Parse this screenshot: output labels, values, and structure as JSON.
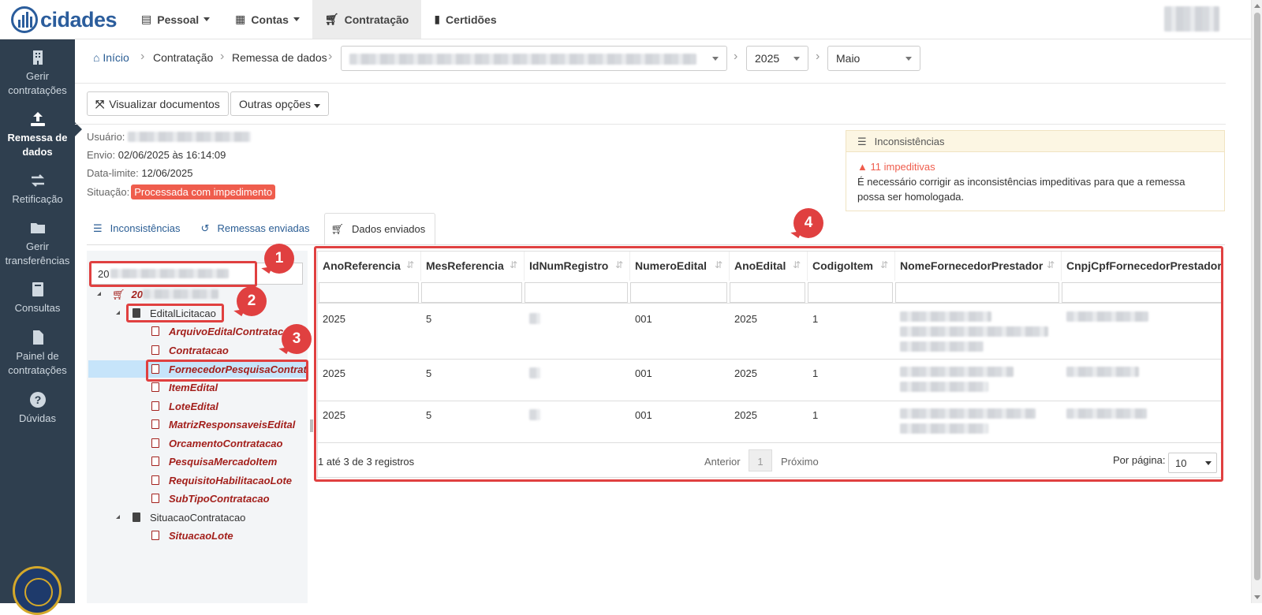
{
  "app": {
    "brand": "cidades"
  },
  "topnav": [
    {
      "label": "Pessoal",
      "icon": "id-card-icon",
      "dropdown": true
    },
    {
      "label": "Contas",
      "icon": "calendar-icon",
      "dropdown": true
    },
    {
      "label": "Contratação",
      "icon": "cart-icon",
      "active": true
    },
    {
      "label": "Certidões",
      "icon": "document-icon"
    }
  ],
  "sidebar": [
    {
      "label": "Gerir contratações",
      "icon": "building-icon"
    },
    {
      "label": "Remessa de dados",
      "icon": "upload-icon",
      "active": true
    },
    {
      "label": "Retificação",
      "icon": "exchange-icon"
    },
    {
      "label": "Gerir transferências",
      "icon": "folder-icon"
    },
    {
      "label": "Consultas",
      "icon": "book-icon"
    },
    {
      "label": "Painel de contratações",
      "icon": "file-icon"
    },
    {
      "label": "Dúvidas",
      "icon": "question-icon"
    }
  ],
  "breadcrumb": {
    "home": "Início",
    "c1": "Contratação",
    "c2": "Remessa de dados"
  },
  "filters": {
    "year": "2025",
    "month": "Maio"
  },
  "toolbar": {
    "view_docs": "Visualizar documentos",
    "more": "Outras opções"
  },
  "info": {
    "user_label": "Usuário:",
    "send_label": "Envio:",
    "send_value": "02/06/2025 às 16:14:09",
    "deadline_label": "Data-limite:",
    "deadline_value": "12/06/2025",
    "status_label": "Situação:",
    "status_value": "Processada com impedimento"
  },
  "inconsistencies": {
    "title": "Inconsistências",
    "count": "11 impeditivas",
    "message": "É necessário corrigir as inconsistências impeditivas para que a remessa possa ser homologada."
  },
  "tabs": [
    {
      "label": "Inconsistências",
      "icon": "list-icon"
    },
    {
      "label": "Remessas enviadas",
      "icon": "history-icon"
    },
    {
      "label": "Dados enviados",
      "icon": "cart-icon",
      "active": true
    }
  ],
  "tree": {
    "search_value": "20",
    "root_label": "20",
    "groups": [
      {
        "label": "EditalLicitacao",
        "items": [
          "ArquivoEditalContratacao",
          "Contratacao",
          "FornecedorPesquisaContratacao",
          "ItemEdital",
          "LoteEdital",
          "MatrizResponsaveisEdital",
          "OrcamentoContratacao",
          "PesquisaMercadoItem",
          "RequisitoHabilitacaoLote",
          "SubTipoContratacao"
        ]
      },
      {
        "label": "SituacaoContratacao",
        "items": [
          "SituacaoLote"
        ]
      }
    ]
  },
  "grid": {
    "columns": [
      "AnoReferencia",
      "MesReferencia",
      "IdNumRegistro",
      "NumeroEdital",
      "AnoEdital",
      "CodigoItem",
      "NomeFornecedorPrestador",
      "CnpjCpfFornecedorPrestador"
    ],
    "rows": [
      [
        "2025",
        "5",
        "",
        "001",
        "2025",
        "1",
        "",
        ""
      ],
      [
        "2025",
        "5",
        "",
        "001",
        "2025",
        "1",
        "",
        ""
      ],
      [
        "2025",
        "5",
        "",
        "001",
        "2025",
        "1",
        "",
        ""
      ]
    ],
    "summary": "1 até 3 de 3 registros",
    "prev": "Anterior",
    "page": "1",
    "next": "Próximo",
    "per_page_label": "Por página:",
    "per_page_value": "10"
  },
  "annotations": [
    "1",
    "2",
    "3",
    "4"
  ],
  "colors": {
    "accent": "#2b5d9c",
    "sidebar": "#2f3f4f",
    "danger": "#ef5d4d",
    "annotation": "#e04040"
  }
}
